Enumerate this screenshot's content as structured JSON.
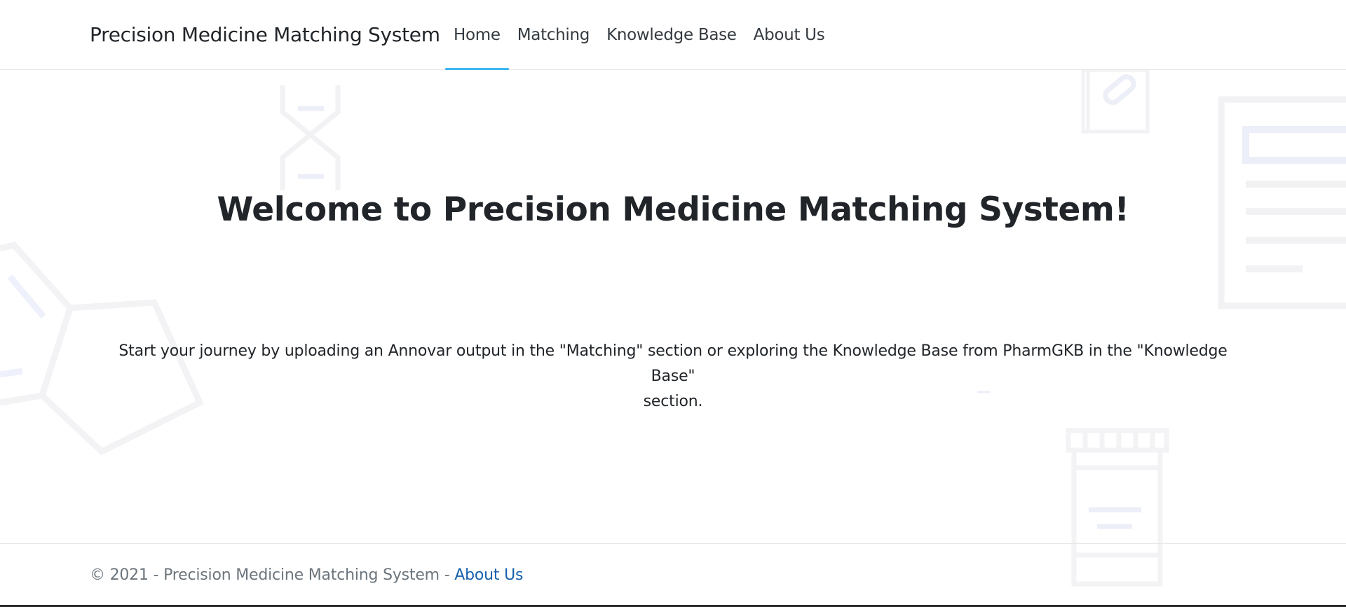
{
  "navbar": {
    "brand": "Precision Medicine Matching System",
    "items": [
      {
        "label": "Home",
        "active": true
      },
      {
        "label": "Matching",
        "active": false
      },
      {
        "label": "Knowledge Base",
        "active": false
      },
      {
        "label": "About Us",
        "active": false
      }
    ],
    "active_underline_color": "#3db9f2"
  },
  "main": {
    "title": "Welcome to Precision Medicine Matching System!",
    "lead_line_1": "Start your journey by uploading an Annovar output in the \"Matching\" section or exploring the Knowledge Base from PharmGKB in the \"Knowledge Base\"",
    "lead_line_2": "section."
  },
  "footer": {
    "text": "© 2021 - Precision Medicine Matching System - ",
    "link_label": "About Us",
    "link_color": "#1861ac"
  },
  "background_icons": [
    "dna-icon",
    "molecule-icon",
    "clipboard-pill-icon",
    "document-icon",
    "pill-bottle-icon"
  ]
}
